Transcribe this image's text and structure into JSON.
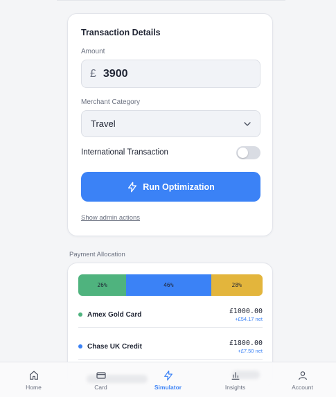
{
  "transaction": {
    "title": "Transaction Details",
    "amount_label": "Amount",
    "currency_symbol": "£",
    "amount_value": "3900",
    "category_label": "Merchant Category",
    "category_value": "Travel",
    "international_label": "International Transaction",
    "international_enabled": false,
    "run_button": "Run Optimization",
    "admin_link": "Show admin actions"
  },
  "allocation": {
    "section_title": "Payment Allocation",
    "segments": [
      {
        "label": "26%",
        "percent": 26,
        "color": "#4fb37e"
      },
      {
        "label": "46%",
        "percent": 46,
        "color": "#3b82f6"
      },
      {
        "label": "28%",
        "percent": 28,
        "color": "#e3b53c"
      }
    ],
    "items": [
      {
        "name": "Amex Gold Card",
        "amount": "£1000.00",
        "net": "+£54.17 net",
        "color": "#4fb37e"
      },
      {
        "name": "Chase UK Credit",
        "amount": "£1800.00",
        "net": "+£7.50 net",
        "color": "#3b82f6"
      }
    ]
  },
  "nav": {
    "items": [
      {
        "label": "Home",
        "icon": "home-icon",
        "active": false
      },
      {
        "label": "Card",
        "icon": "card-icon",
        "active": false
      },
      {
        "label": "Simulator",
        "icon": "bolt-icon",
        "active": true
      },
      {
        "label": "Insights",
        "icon": "bar-chart-icon",
        "active": false
      },
      {
        "label": "Account",
        "icon": "user-icon",
        "active": false
      }
    ]
  },
  "colors": {
    "accent": "#3b82f6",
    "background": "#f4f5f7",
    "card": "#ffffff"
  }
}
